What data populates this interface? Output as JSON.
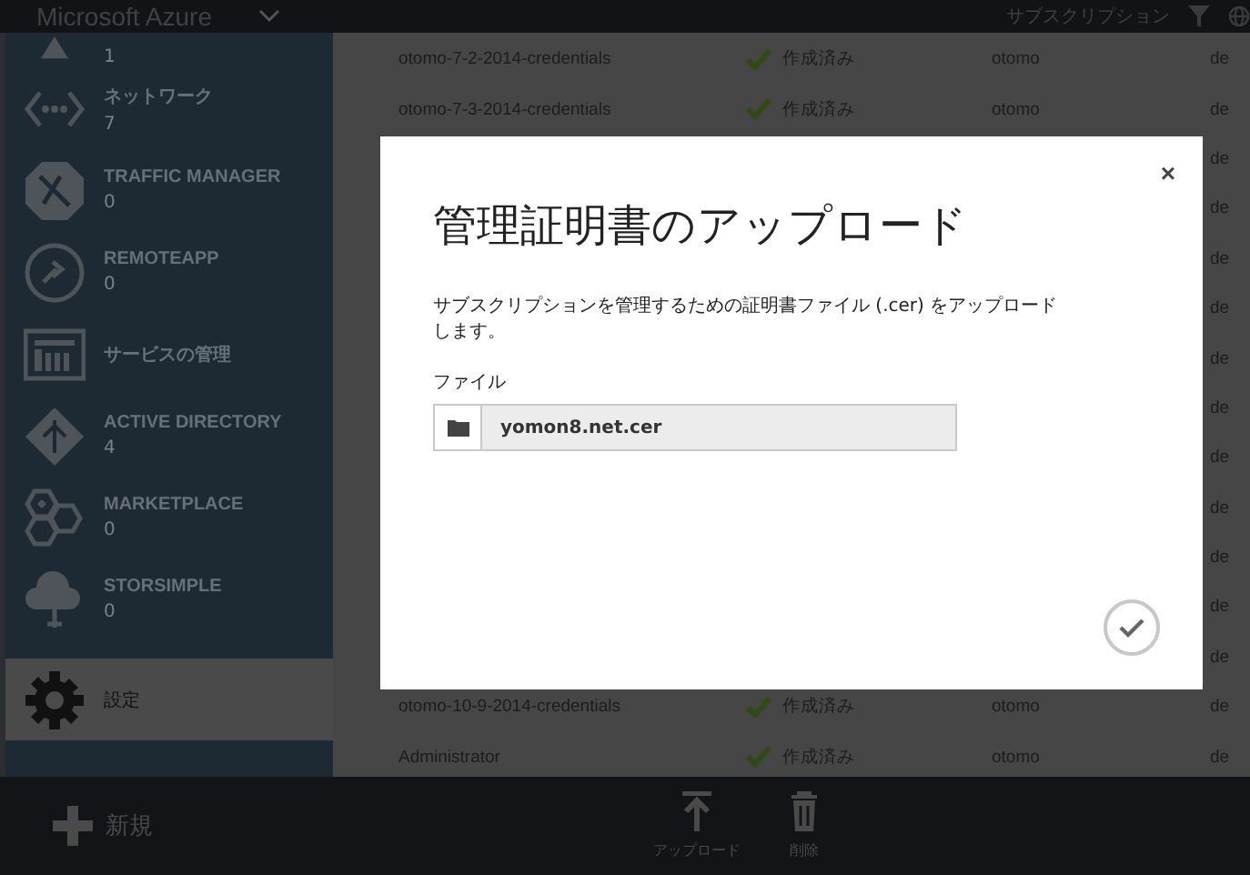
{
  "header": {
    "brand": "Microsoft Azure",
    "subscription_label": "サブスクリプション"
  },
  "sidebar": {
    "items": [
      {
        "count": "1",
        "selected": false
      },
      {
        "label": "ネットワーク",
        "count": "7",
        "selected": false
      },
      {
        "label": "TRAFFIC MANAGER",
        "count": "0",
        "selected": false
      },
      {
        "label": "REMOTEAPP",
        "count": "0",
        "selected": false
      },
      {
        "label": "サービスの管理",
        "selected": false
      },
      {
        "label": "ACTIVE DIRECTORY",
        "count": "4",
        "selected": false
      },
      {
        "label": "MARKETPLACE",
        "count": "0",
        "selected": false
      },
      {
        "label": "STORSIMPLE",
        "count": "0",
        "selected": false
      },
      {
        "label": "設定",
        "selected": true
      }
    ]
  },
  "table": {
    "rows": [
      {
        "column_1": "otomo-7-2-2014-credentials",
        "column_2": "作成済み",
        "column_3": "otomo",
        "column_4": "de"
      },
      {
        "column_1": "otomo-7-3-2014-credentials",
        "column_2": "作成済み",
        "column_3": "otomo",
        "column_4": "de"
      },
      {
        "column_4": "de"
      },
      {
        "column_4": "de"
      },
      {
        "column_4": "de"
      },
      {
        "column_4": "de"
      },
      {
        "column_4": "de"
      },
      {
        "column_4": "de"
      },
      {
        "column_4": "de"
      },
      {
        "column_4": "de"
      },
      {
        "column_4": "de"
      },
      {
        "column_4": "de"
      },
      {
        "column_4": "de"
      },
      {
        "column_1": "otomo-10-9-2014-credentials",
        "column_2": "作成済み",
        "column_3": "otomo",
        "column_4": "de"
      },
      {
        "column_1": "Administrator",
        "column_2": "作成済み",
        "column_3": "otomo",
        "column_4": "de"
      }
    ]
  },
  "dialog": {
    "title": "管理証明書のアップロード",
    "close": "×",
    "description": "サブスクリプションを管理するための証明書ファイル (.cer) をアップロードします。",
    "file_label": "ファイル",
    "file_value": "yomon8.net.cer"
  },
  "command_bar": {
    "new_label": "新規",
    "actions": [
      {
        "label": "アップロード"
      },
      {
        "label": "削除"
      }
    ]
  }
}
